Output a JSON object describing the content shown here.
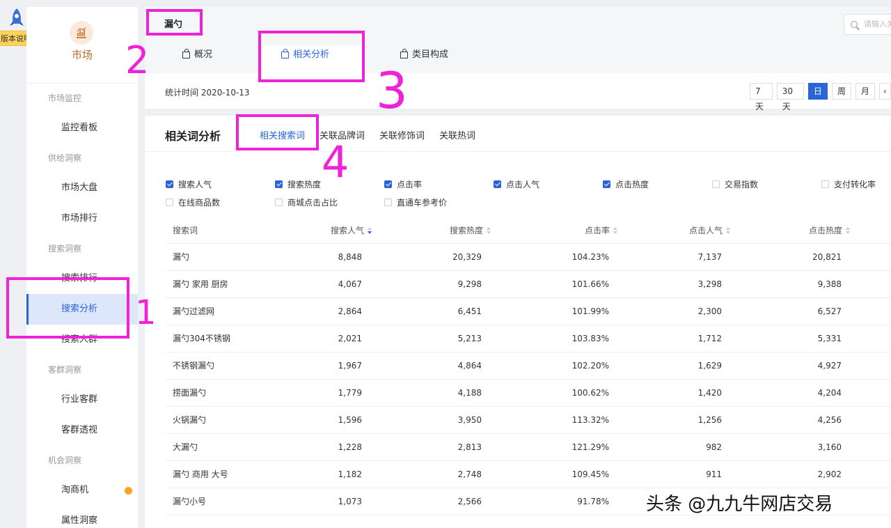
{
  "app": {
    "version_badge": "版本说明"
  },
  "sidebar": {
    "title": "市场",
    "groups": [
      {
        "label": "市场监控",
        "items": [
          {
            "label": "监控看板"
          }
        ]
      },
      {
        "label": "供给洞察",
        "items": [
          {
            "label": "市场大盘"
          },
          {
            "label": "市场排行"
          }
        ]
      },
      {
        "label": "搜索洞察",
        "items": [
          {
            "label": "搜索排行"
          },
          {
            "label": "搜索分析",
            "active": true
          },
          {
            "label": "搜索人群"
          }
        ]
      },
      {
        "label": "客群洞察",
        "items": [
          {
            "label": "行业客群"
          },
          {
            "label": "客群透视"
          }
        ]
      },
      {
        "label": "机会洞察",
        "items": [
          {
            "label": "淘商机",
            "badge": true
          },
          {
            "label": "属性洞察"
          }
        ]
      }
    ]
  },
  "header": {
    "keyword": "漏勺",
    "search_placeholder": "请输入关",
    "tabs": [
      {
        "label": "概况"
      },
      {
        "label": "相关分析",
        "active": true
      },
      {
        "label": "类目构成"
      }
    ],
    "stat_time": "统计时间 2020-10-13",
    "periods": [
      "7天",
      "30天",
      "日",
      "周",
      "月"
    ],
    "active_period": "日"
  },
  "analysis": {
    "title": "相关词分析",
    "subtabs": [
      "相关搜索词",
      "关联品牌词",
      "关联修饰词",
      "关联热词"
    ],
    "active_subtab": "相关搜索词",
    "metrics": [
      {
        "label": "搜索人气",
        "checked": true
      },
      {
        "label": "搜索热度",
        "checked": true
      },
      {
        "label": "点击率",
        "checked": true
      },
      {
        "label": "点击人气",
        "checked": true
      },
      {
        "label": "点击热度",
        "checked": true
      },
      {
        "label": "交易指数",
        "checked": false
      },
      {
        "label": "支付转化率",
        "checked": false
      },
      {
        "label": "在线商品数",
        "checked": false
      },
      {
        "label": "商城点击占比",
        "checked": false
      },
      {
        "label": "直通车参考价",
        "checked": false
      }
    ],
    "table": {
      "columns": [
        "搜索词",
        "搜索人气",
        "搜索热度",
        "点击率",
        "点击人气",
        "点击热度"
      ],
      "rows": [
        [
          "漏勺",
          "8,848",
          "20,329",
          "104.23%",
          "7,137",
          "20,821"
        ],
        [
          "漏勺 家用 厨房",
          "4,067",
          "9,298",
          "101.66%",
          "3,298",
          "9,388"
        ],
        [
          "漏勺过滤网",
          "2,864",
          "6,451",
          "101.99%",
          "2,300",
          "6,527"
        ],
        [
          "漏勺304不锈钢",
          "2,021",
          "5,213",
          "103.83%",
          "1,712",
          "5,331"
        ],
        [
          "不锈钢漏勺",
          "1,967",
          "4,864",
          "102.20%",
          "1,629",
          "4,927"
        ],
        [
          "捞面漏勺",
          "1,779",
          "4,188",
          "100.62%",
          "1,420",
          "4,204"
        ],
        [
          "火锅漏勺",
          "1,596",
          "3,950",
          "113.32%",
          "1,256",
          "4,256"
        ],
        [
          "大漏勺",
          "1,228",
          "2,813",
          "121.29%",
          "982",
          "3,160"
        ],
        [
          "漏勺 商用 大号",
          "1,182",
          "2,748",
          "109.45%",
          "911",
          "2,902"
        ],
        [
          "漏勺小号",
          "1,073",
          "2,566",
          "91.78%",
          "",
          ""
        ]
      ]
    }
  },
  "annotations": {
    "marks": [
      "1",
      "2",
      "3",
      "4"
    ],
    "color": "#ee22d8"
  },
  "watermark": "头条 @九九牛网店交易",
  "colors": {
    "accent": "#2a64d8",
    "market": "#b86a2c",
    "badge": "#f5a524"
  }
}
